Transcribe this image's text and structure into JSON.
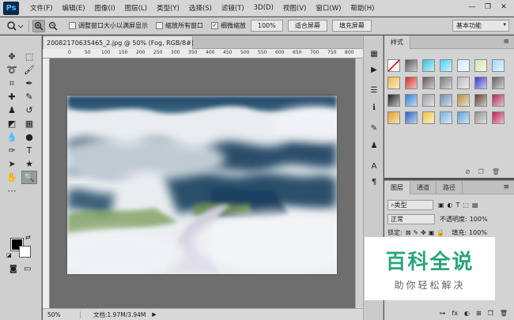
{
  "app": {
    "logo": "Ps"
  },
  "menu": [
    "文件(F)",
    "编辑(E)",
    "图像(I)",
    "图层(L)",
    "类型(Y)",
    "选择(S)",
    "滤镜(T)",
    "3D(D)",
    "视图(V)",
    "窗口(W)",
    "帮助(H)"
  ],
  "window_controls": {
    "minimize": "—",
    "restore": "❐",
    "close": "✕"
  },
  "options": {
    "resize_windows_label": "调整窗口大小以满屏显示",
    "zoom_all_label": "缩放所有窗口",
    "scrubby_zoom_label": "细微缩放",
    "scrubby_checked": true,
    "zoom_100_label": "100%",
    "fit_screen_label": "适合屏幕",
    "fill_screen_label": "填充屏幕",
    "workspace": "基本功能"
  },
  "document": {
    "tab_title": "20082170635465_2.jpg @ 50% (Fog, RGB/8#) *",
    "tab_close": "×",
    "ruler_labels": [
      "0",
      "50",
      "100",
      "150",
      "200",
      "250",
      "300",
      "350",
      "400",
      "450",
      "500",
      "550",
      "600",
      "650",
      "700",
      "750",
      "800"
    ],
    "status_zoom": "50%",
    "status_doc": "文档:1.97M/3.94M",
    "status_arrow": "▶"
  },
  "styles_panel": {
    "tab": "样式",
    "menu": "≡",
    "swatches": [
      "#ffffff",
      "#555555",
      "#39c0e0",
      "#4ad0ff",
      "#cceeff",
      "#d4e6b0",
      "#a0d8ff",
      "#f2b64a",
      "#d0302a",
      "#5a5a5a",
      "#777777",
      "#bbbbbb",
      "#3a3acc",
      "#606060",
      "#222222",
      "#2c7fd6",
      "#a0a0a0",
      "#6f8ab0",
      "#b09040",
      "#604030",
      "#b02858",
      "#e0a020",
      "#2a60c0",
      "#f0c040",
      "#7ab0e0",
      "#5aa0d0",
      "#909090",
      "#c02060"
    ],
    "footer_icons": [
      "⊘",
      "❐",
      "🗑"
    ]
  },
  "layers_panel": {
    "tabs": [
      "图层",
      "通道",
      "路径"
    ],
    "menu": "≡",
    "kind_label": "类型",
    "blend_mode": "正常",
    "opacity_label": "不透明度:",
    "opacity_value": "100%",
    "lock_label": "锁定:",
    "fill_label": "填充:",
    "fill_value": "100%",
    "footer_icons": [
      "⊶",
      "fx",
      "◐",
      "⊞",
      "❐",
      "🗑"
    ]
  },
  "watermark": {
    "title": "百科全说",
    "subtitle": "助你轻松解决"
  }
}
